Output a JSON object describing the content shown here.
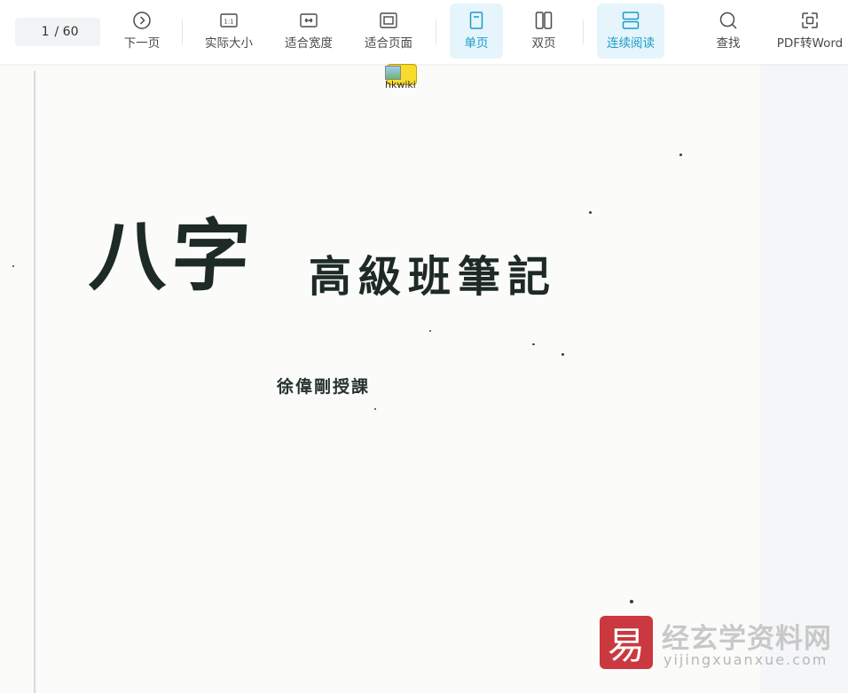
{
  "toolbar": {
    "page": {
      "current": "1",
      "total": "/ 60"
    },
    "tools": [
      {
        "label": "下一页",
        "icon": "next-page-icon",
        "active": false
      },
      {
        "label": "实际大小",
        "icon": "actual-size-icon",
        "active": false
      },
      {
        "label": "适合宽度",
        "icon": "fit-width-icon",
        "active": false
      },
      {
        "label": "适合页面",
        "icon": "fit-page-icon",
        "active": false
      },
      {
        "label": "单页",
        "icon": "single-page-icon",
        "active": true
      },
      {
        "label": "双页",
        "icon": "double-page-icon",
        "active": false
      },
      {
        "label": "连续阅读",
        "icon": "continuous-read-icon",
        "active": true
      },
      {
        "label": "查找",
        "icon": "search-icon",
        "active": false
      },
      {
        "label": "PDF转Word",
        "icon": "pdf-to-word-icon",
        "active": false
      }
    ]
  },
  "document": {
    "title_main": "八字",
    "title_sub": "高級班筆記",
    "author": "徐偉剛授課",
    "broken_image_alt": "hkwiki"
  },
  "watermark": {
    "logo_glyph": "易",
    "site_name": "经玄学资料网",
    "url": "yijingxuanxue.com"
  },
  "colors": {
    "accent": "#1a9bc9",
    "active_bg": "#e6f5fb",
    "watermark_red": "#c9393f"
  }
}
